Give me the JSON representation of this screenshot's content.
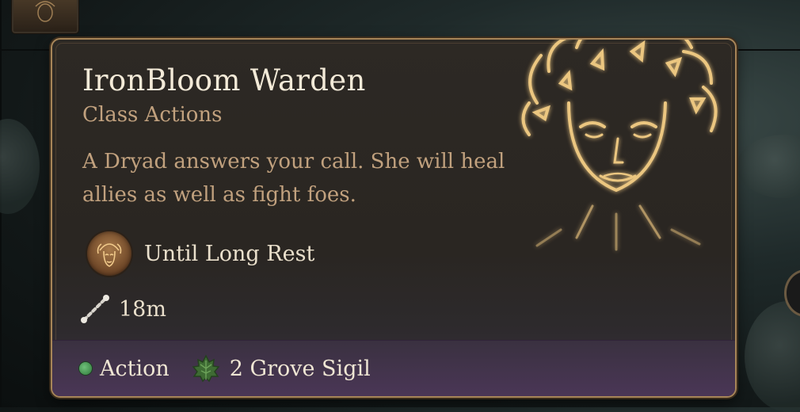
{
  "tooltip": {
    "title": "IronBloom Warden",
    "subtitle": "Class Actions",
    "description": "A Dryad answers your call. She will heal allies as well as fight foes.",
    "duration": {
      "label": "Until Long Rest",
      "icon": "dryad-portrait-icon"
    },
    "range": {
      "label": "18m",
      "icon": "range-ruler-icon"
    },
    "footer": {
      "action_label": "Action",
      "action_color": "#3f9a4c",
      "resource_label": "2 Grove Sigil",
      "resource_icon": "leaf-icon"
    },
    "border_color": "#a78558",
    "art_icon": "glowing-dryad-face-icon"
  }
}
